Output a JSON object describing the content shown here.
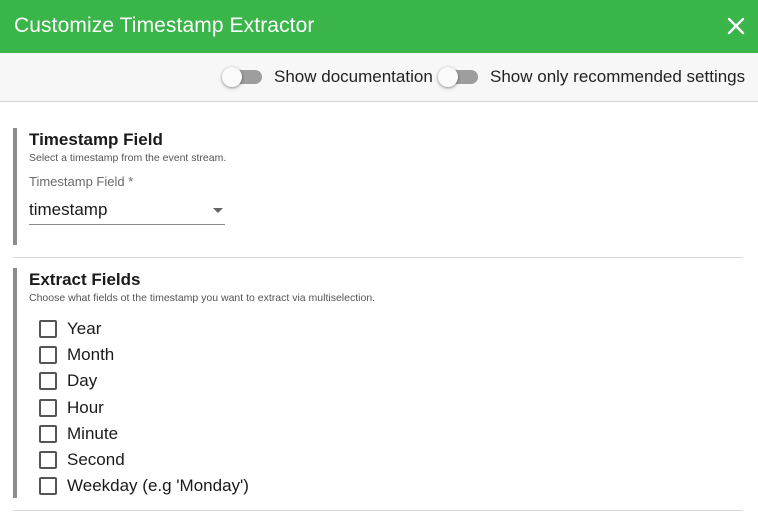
{
  "dialog": {
    "title": "Customize Timestamp Extractor",
    "close_icon": "close-icon"
  },
  "options": {
    "show_documentation": {
      "label": "Show documentation",
      "on": false
    },
    "show_recommended": {
      "label": "Show only recommended settings",
      "on": false
    }
  },
  "timestamp_section": {
    "title": "Timestamp Field",
    "description": "Select a timestamp from the event stream.",
    "field_label": "Timestamp Field *",
    "selected_value": "timestamp"
  },
  "extract_section": {
    "title": "Extract Fields",
    "description": "Choose what fields ot the timestamp you want to extract via multiselection.",
    "options": [
      {
        "label": "Year",
        "checked": false
      },
      {
        "label": "Month",
        "checked": false
      },
      {
        "label": "Day",
        "checked": false
      },
      {
        "label": "Hour",
        "checked": false
      },
      {
        "label": "Minute",
        "checked": false
      },
      {
        "label": "Second",
        "checked": false
      },
      {
        "label": "Weekday (e.g 'Monday')",
        "checked": false
      }
    ]
  },
  "colors": {
    "header": "#39b54a",
    "section_border": "#8c8c8c"
  }
}
